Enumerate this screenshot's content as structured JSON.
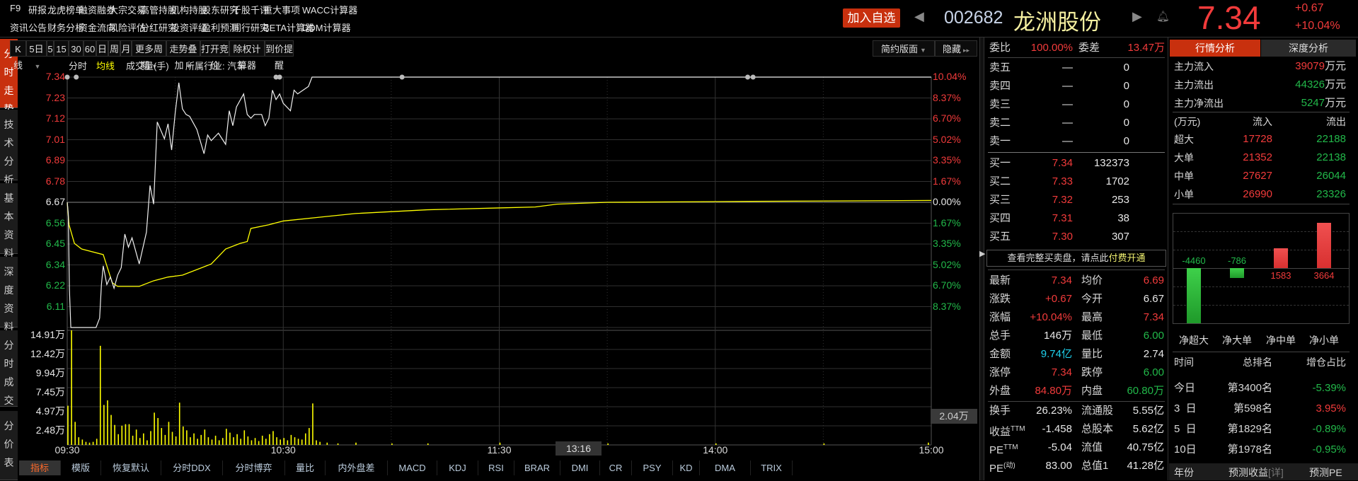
{
  "top_menu": {
    "row1": [
      "F9",
      "研报",
      "龙虎榜单",
      "融资融券",
      "大宗交易",
      "高管持股",
      "机构持股",
      "股东研究",
      "千股千评",
      "重大事项",
      "WACC计算器"
    ],
    "row2": [
      "资讯",
      "公告",
      "财务分析",
      "资金流向",
      "风险评估",
      "分红研究",
      "投资评级",
      "盈利预测",
      "同行研究",
      "BETA计算器",
      "DDM计算器"
    ]
  },
  "header": {
    "add_watch": "加入自选",
    "code": "002682",
    "name": "龙洲股份",
    "price": "7.34",
    "change": "+0.67",
    "change_pct": "+10.04%"
  },
  "side_tabs": [
    "分时走势",
    "技术分析",
    "基本资料",
    "深度资料",
    "分时成交",
    "分价表"
  ],
  "toolbar": [
    {
      "label": "K线"
    },
    {
      "label": "5日",
      "dropdown": true
    },
    {
      "label": "5"
    },
    {
      "label": "15"
    },
    {
      "label": "30"
    },
    {
      "label": "60"
    },
    {
      "label": "日"
    },
    {
      "label": "周"
    },
    {
      "label": "月"
    },
    {
      "label": "更多周期",
      "dropdown": true
    },
    {
      "label": "走势叠加",
      "dropdown": true
    },
    {
      "label": "打开竞价"
    },
    {
      "label": "除权计算器"
    },
    {
      "label": "到价提醒"
    }
  ],
  "chart_controls": {
    "layout": "简约版面",
    "hide": "隐藏"
  },
  "legend": {
    "intraday": "分时",
    "avg": "均线",
    "volume": "成交量(手)",
    "industry": "所属行业: 汽车"
  },
  "chart_data": {
    "type": "line",
    "prev_close": 6.67,
    "ylim": [
      6.0,
      7.34
    ],
    "price_labels": [
      {
        "v": "7.34",
        "c": "#f23b3b"
      },
      {
        "v": "7.23",
        "c": "#f23b3b"
      },
      {
        "v": "7.12",
        "c": "#f23b3b"
      },
      {
        "v": "7.01",
        "c": "#f23b3b"
      },
      {
        "v": "6.89",
        "c": "#f23b3b"
      },
      {
        "v": "6.78",
        "c": "#f23b3b"
      },
      {
        "v": "6.67",
        "c": "#e8e8e8"
      },
      {
        "v": "6.56",
        "c": "#22b94a"
      },
      {
        "v": "6.45",
        "c": "#22b94a"
      },
      {
        "v": "6.34",
        "c": "#22b94a"
      },
      {
        "v": "6.22",
        "c": "#22b94a"
      },
      {
        "v": "6.11",
        "c": "#22b94a"
      }
    ],
    "pct_labels": [
      {
        "v": "10.04%",
        "c": "#f23b3b"
      },
      {
        "v": "8.37%",
        "c": "#f23b3b"
      },
      {
        "v": "6.70%",
        "c": "#f23b3b"
      },
      {
        "v": "5.02%",
        "c": "#f23b3b"
      },
      {
        "v": "3.35%",
        "c": "#f23b3b"
      },
      {
        "v": "1.67%",
        "c": "#f23b3b"
      },
      {
        "v": "0.00%",
        "c": "#e8e8e8"
      },
      {
        "v": "1.67%",
        "c": "#22b94a"
      },
      {
        "v": "3.35%",
        "c": "#22b94a"
      },
      {
        "v": "5.02%",
        "c": "#22b94a"
      },
      {
        "v": "6.70%",
        "c": "#22b94a"
      },
      {
        "v": "8.37%",
        "c": "#22b94a"
      }
    ],
    "volume_labels": [
      "14.91万",
      "12.42万",
      "9.94万",
      "7.45万",
      "4.97万",
      "2.48万"
    ],
    "volume_max": 14.91,
    "time_labels": [
      {
        "t": "09:30",
        "m": 0
      },
      {
        "t": "10:30",
        "m": 60
      },
      {
        "t": "11:30",
        "m": 120
      },
      {
        "t": "14:00",
        "m": 180
      },
      {
        "t": "15:00",
        "m": 240
      }
    ],
    "cursor_time": "13:16",
    "volume_readout": "2.04万",
    "price_series": [
      [
        0,
        6.67
      ],
      [
        0.3,
        6.61
      ],
      [
        0.6,
        6.21
      ],
      [
        1,
        6.0
      ],
      [
        8,
        6.0
      ],
      [
        9,
        6.05
      ],
      [
        9.5,
        6.23
      ],
      [
        10,
        6.33
      ],
      [
        11,
        6.23
      ],
      [
        12,
        6.27
      ],
      [
        13,
        6.21
      ],
      [
        14,
        6.28
      ],
      [
        15,
        6.32
      ],
      [
        16,
        6.5
      ],
      [
        17,
        6.43
      ],
      [
        18,
        6.48
      ],
      [
        20,
        6.34
      ],
      [
        22,
        6.51
      ],
      [
        23,
        6.76
      ],
      [
        24,
        6.66
      ],
      [
        25,
        7.1
      ],
      [
        27,
        7.01
      ],
      [
        28,
        7.09
      ],
      [
        29,
        6.95
      ],
      [
        30,
        7.15
      ],
      [
        31,
        7.31
      ],
      [
        32,
        7.17
      ],
      [
        33,
        7.14
      ],
      [
        34,
        7.13
      ],
      [
        36,
        7.06
      ],
      [
        38,
        6.93
      ],
      [
        39,
        7.03
      ],
      [
        40,
        7.0
      ],
      [
        42,
        7.04
      ],
      [
        44,
        6.98
      ],
      [
        45,
        7.16
      ],
      [
        46,
        7.08
      ],
      [
        47,
        7.18
      ],
      [
        49,
        7.25
      ],
      [
        50,
        7.14
      ],
      [
        51,
        7.12
      ],
      [
        52,
        7.14
      ],
      [
        54,
        7.14
      ],
      [
        55,
        7.08
      ],
      [
        56,
        7.12
      ],
      [
        57,
        7.27
      ],
      [
        58,
        7.22
      ],
      [
        59,
        7.25
      ],
      [
        60,
        7.2
      ],
      [
        62,
        7.16
      ],
      [
        63,
        7.27
      ],
      [
        64,
        7.25
      ],
      [
        67,
        7.29
      ],
      [
        68,
        7.34
      ],
      [
        240,
        7.34
      ]
    ],
    "avg_series": [
      [
        0,
        6.67
      ],
      [
        0.5,
        6.55
      ],
      [
        2,
        6.45
      ],
      [
        4,
        6.42
      ],
      [
        10,
        6.39
      ],
      [
        12.5,
        6.24
      ],
      [
        14,
        6.22
      ],
      [
        20,
        6.22
      ],
      [
        24,
        6.25
      ],
      [
        28,
        6.27
      ],
      [
        32,
        6.28
      ],
      [
        36,
        6.31
      ],
      [
        40,
        6.34
      ],
      [
        44,
        6.42
      ],
      [
        48,
        6.45
      ],
      [
        50,
        6.46
      ],
      [
        51,
        6.53
      ],
      [
        56,
        6.55
      ],
      [
        60,
        6.57
      ],
      [
        70,
        6.59
      ],
      [
        80,
        6.61
      ],
      [
        100,
        6.63
      ],
      [
        120,
        6.64
      ],
      [
        130,
        6.645
      ],
      [
        136,
        6.66
      ],
      [
        150,
        6.67
      ],
      [
        190,
        6.675
      ],
      [
        240,
        6.68
      ]
    ],
    "volume_series": [
      [
        0,
        5.1
      ],
      [
        1,
        15.5
      ],
      [
        2,
        3.0
      ],
      [
        3,
        1.0
      ],
      [
        4,
        0.7
      ],
      [
        5,
        0.4
      ],
      [
        6,
        0.3
      ],
      [
        7,
        0.4
      ],
      [
        8,
        0.8
      ],
      [
        9,
        12.9
      ],
      [
        10,
        5.2
      ],
      [
        11,
        5.8
      ],
      [
        12,
        3.9
      ],
      [
        13,
        2.6
      ],
      [
        14,
        1.4
      ],
      [
        15,
        2.5
      ],
      [
        16,
        2.7
      ],
      [
        17,
        2.7
      ],
      [
        18,
        1.2
      ],
      [
        19,
        2.0
      ],
      [
        20,
        0.9
      ],
      [
        21,
        1.5
      ],
      [
        22,
        0.6
      ],
      [
        23,
        1.8
      ],
      [
        24,
        4.2
      ],
      [
        25,
        3.5
      ],
      [
        26,
        2.2
      ],
      [
        27,
        1.3
      ],
      [
        28,
        3.0
      ],
      [
        29,
        1.7
      ],
      [
        30,
        1.1
      ],
      [
        31,
        5.5
      ],
      [
        32,
        2.4
      ],
      [
        33,
        1.9
      ],
      [
        34,
        1.0
      ],
      [
        35,
        1.5
      ],
      [
        36,
        0.8
      ],
      [
        37,
        1.3
      ],
      [
        38,
        2.0
      ],
      [
        39,
        1.0
      ],
      [
        40,
        0.7
      ],
      [
        41,
        1.2
      ],
      [
        42,
        0.6
      ],
      [
        43,
        0.9
      ],
      [
        44,
        2.1
      ],
      [
        45,
        1.6
      ],
      [
        46,
        1.0
      ],
      [
        47,
        1.4
      ],
      [
        48,
        0.8
      ],
      [
        49,
        1.9
      ],
      [
        50,
        1.1
      ],
      [
        51,
        0.6
      ],
      [
        52,
        0.9
      ],
      [
        53,
        0.5
      ],
      [
        54,
        1.2
      ],
      [
        55,
        0.8
      ],
      [
        56,
        1.4
      ],
      [
        57,
        1.8
      ],
      [
        58,
        1.0
      ],
      [
        59,
        0.7
      ],
      [
        60,
        0.9
      ],
      [
        61,
        0.6
      ],
      [
        62,
        1.3
      ],
      [
        63,
        1.0
      ],
      [
        64,
        0.8
      ],
      [
        65,
        0.7
      ],
      [
        66,
        1.5
      ],
      [
        67,
        2.2
      ],
      [
        68,
        5.4
      ],
      [
        69,
        0.6
      ],
      [
        70,
        0.4
      ],
      [
        72,
        0.3
      ],
      [
        75,
        0.2
      ],
      [
        80,
        0.3
      ],
      [
        90,
        0.2
      ],
      [
        100,
        0.2
      ],
      [
        120,
        0.3
      ],
      [
        150,
        0.2
      ],
      [
        180,
        0.2
      ],
      [
        210,
        0.2
      ],
      [
        239,
        0.3
      ]
    ]
  },
  "bottom_tabs": [
    "指标",
    "模版",
    "恢复默认",
    "分时DDX",
    "分时博弈",
    "量比",
    "内外盘差",
    "MACD",
    "KDJ",
    "RSI",
    "BRAR",
    "DMI",
    "CR",
    "PSY",
    "KD",
    "DMA",
    "TRIX"
  ],
  "order_book": {
    "ratio_label": "委比",
    "ratio": "100.00%",
    "diff_label": "委差",
    "diff": "13.47万",
    "asks": [
      {
        "label": "卖五",
        "price": "—",
        "vol": "0"
      },
      {
        "label": "卖四",
        "price": "—",
        "vol": "0"
      },
      {
        "label": "卖三",
        "price": "—",
        "vol": "0"
      },
      {
        "label": "卖二",
        "price": "—",
        "vol": "0"
      },
      {
        "label": "卖一",
        "price": "—",
        "vol": "0"
      }
    ],
    "bids": [
      {
        "label": "买一",
        "price": "7.34",
        "vol": "132373"
      },
      {
        "label": "买二",
        "price": "7.33",
        "vol": "1702"
      },
      {
        "label": "买三",
        "price": "7.32",
        "vol": "253"
      },
      {
        "label": "买四",
        "price": "7.31",
        "vol": "38"
      },
      {
        "label": "买五",
        "price": "7.30",
        "vol": "307"
      }
    ],
    "full_depth_text": "查看完整买卖盘，请点此",
    "full_depth_link": "付费开通"
  },
  "stats": [
    {
      "l1": "最新",
      "v1": "7.34",
      "c1": "#f23b3b",
      "l2": "均价",
      "v2": "6.69",
      "c2": "#f23b3b"
    },
    {
      "l1": "涨跌",
      "v1": "+0.67",
      "c1": "#f23b3b",
      "l2": "今开",
      "v2": "6.67",
      "c2": "#e8e8e8"
    },
    {
      "l1": "涨幅",
      "v1": "+10.04%",
      "c1": "#f23b3b",
      "l2": "最高",
      "v2": "7.34",
      "c2": "#f23b3b"
    },
    {
      "l1": "总手",
      "v1": "146万",
      "c1": "#e8e8e8",
      "l2": "最低",
      "v2": "6.00",
      "c2": "#22b94a"
    },
    {
      "l1": "金额",
      "v1": "9.74亿",
      "c1": "#1fd2ee",
      "l2": "量比",
      "v2": "2.74",
      "c2": "#e8e8e8"
    },
    {
      "l1": "涨停",
      "v1": "7.34",
      "c1": "#f23b3b",
      "l2": "跌停",
      "v2": "6.00",
      "c2": "#22b94a"
    },
    {
      "l1": "外盘",
      "v1": "84.80万",
      "c1": "#f23b3b",
      "l2": "内盘",
      "v2": "60.80万",
      "c2": "#22b94a"
    }
  ],
  "stats2": [
    {
      "l1": "换手",
      "sup": "",
      "v1": "26.23%",
      "l2": "流通股",
      "v2": "5.55亿"
    },
    {
      "l1": "收益",
      "sup": "TTM",
      "v1": "-1.458",
      "l2": "总股本",
      "v2": "5.62亿"
    },
    {
      "l1": "PE",
      "sup": "TTM",
      "v1": "-5.04",
      "l2": "流值",
      "v2": "40.75亿"
    },
    {
      "l1": "PE",
      "sup": "(动)",
      "v1": "83.00",
      "l2": "总值1",
      "v2": "41.28亿"
    }
  ],
  "capital_flow": {
    "tabs": [
      "行情分析",
      "深度分析"
    ],
    "main": [
      {
        "label": "主力流入",
        "value": "39079",
        "unit": "万元",
        "c": "#f23b3b"
      },
      {
        "label": "主力流出",
        "value": "44326",
        "unit": "万元",
        "c": "#22b94a"
      },
      {
        "label": "主力净流出",
        "value": "5247",
        "unit": "万元",
        "c": "#22b94a"
      }
    ],
    "table_head": [
      "(万元)",
      "流入",
      "流出"
    ],
    "rows": [
      {
        "label": "超大",
        "in": "17728",
        "out": "22188"
      },
      {
        "label": "大单",
        "in": "21352",
        "out": "22138"
      },
      {
        "label": "中单",
        "in": "27627",
        "out": "26044"
      },
      {
        "label": "小单",
        "in": "26990",
        "out": "23326"
      }
    ],
    "net_bars": [
      {
        "label": "净超大",
        "value": -4460
      },
      {
        "label": "净大单",
        "value": -786
      },
      {
        "label": "净中单",
        "value": 1583
      },
      {
        "label": "净小单",
        "value": 3664
      }
    ]
  },
  "ranking": {
    "head": [
      "时间",
      "总排名",
      "增仓占比"
    ],
    "rows": [
      {
        "t": "今日",
        "rank": "第3400名",
        "pct": "-5.39%",
        "c": "#22b94a"
      },
      {
        "t": "3  日",
        "rank": "第598名",
        "pct": "3.95%",
        "c": "#f23b3b"
      },
      {
        "t": "5  日",
        "rank": "第1829名",
        "pct": "-0.89%",
        "c": "#22b94a"
      },
      {
        "t": "10日",
        "rank": "第1978名",
        "pct": "-0.95%",
        "c": "#22b94a"
      }
    ],
    "footer": {
      "year": "年份",
      "eps": "预测收益",
      "detail": "[详]",
      "pe": "预测PE"
    }
  }
}
